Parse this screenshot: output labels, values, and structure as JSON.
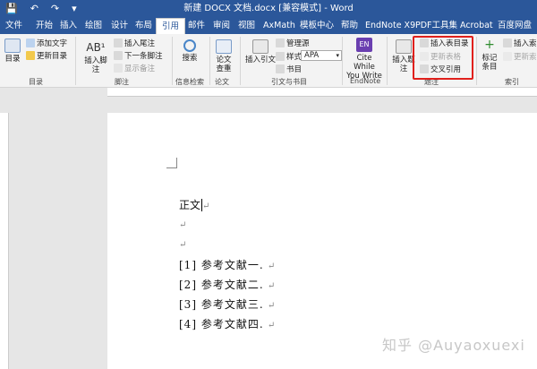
{
  "titlebar": {
    "quick_access": [
      "💾",
      "↶",
      "↷",
      "▾"
    ],
    "title": "新建 DOCX 文档.docx [兼容模式] - Word"
  },
  "tabs": [
    "文件",
    "开始",
    "插入",
    "绘图",
    "设计",
    "布局",
    "引用",
    "邮件",
    "审阅",
    "视图",
    "AxMath",
    "模板中心",
    "帮助",
    "EndNote X9",
    "PDF工具集",
    "Acrobat",
    "百度网盘"
  ],
  "ribbon": {
    "toc": {
      "big": "目录",
      "add_text": "添加文字",
      "update": "更新目录",
      "group": "目录"
    },
    "footnote": {
      "big": "插入脚注",
      "endnote": "插入尾注",
      "next": "下一条脚注",
      "show": "显示备注",
      "group": "脚注"
    },
    "research": {
      "big": "搜索",
      "group": "信息检索"
    },
    "paper": {
      "big": "论文查重",
      "group": "论文"
    },
    "citation": {
      "big": "插入引文",
      "manage": "管理源",
      "style_label": "样式:",
      "style_value": "APA",
      "bib": "书目",
      "group": "引文与书目"
    },
    "endnote": {
      "big": "Cite While You Write",
      "group": "EndNote"
    },
    "caption": {
      "big": "插入题注",
      "table_of_figures": "插入表目录",
      "update_table": "更新表格",
      "cross_ref": "交叉引用",
      "group": "题注"
    },
    "index": {
      "big": "标记条目",
      "insert_index": "插入索引",
      "update_index": "更新索引",
      "group": "索引"
    }
  },
  "document": {
    "lines": [
      "正文",
      "",
      "",
      "[1]  参考文献一.",
      "[2]  参考文献二.",
      "[3]  参考文献三.",
      "[4]  参考文献四."
    ],
    "watermark": "知乎 @Auyaoxuexi"
  },
  "colors": {
    "accent": "#2b579a",
    "highlight_box": "#e0201c"
  }
}
